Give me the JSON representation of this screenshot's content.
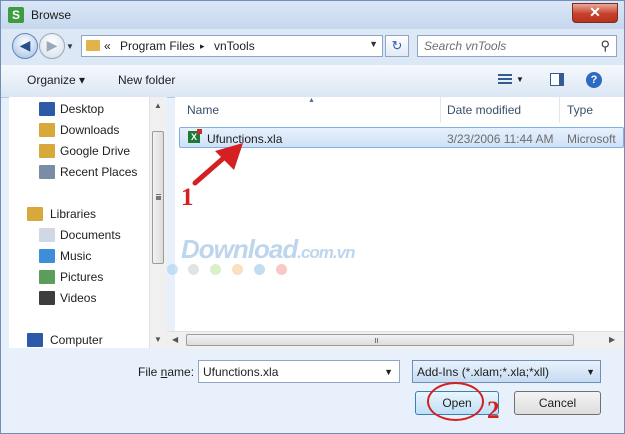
{
  "titlebar": {
    "title": "Browse",
    "close_glyph": "✕",
    "app_icon_letter": "S"
  },
  "nav": {
    "breadcrumb_prefix": "«",
    "crumbs": [
      "Program Files",
      "vnTools"
    ],
    "crumb_sep": "▸",
    "search_placeholder": "Search vnTools"
  },
  "toolbar": {
    "organize": "Organize ▾",
    "new_folder": "New folder",
    "help": "?"
  },
  "sidebar": {
    "items": [
      {
        "label": "Desktop",
        "icon": "desktop-icon",
        "color": "#2c5aa8"
      },
      {
        "label": "Downloads",
        "icon": "downloads-folder-icon",
        "color": "#d9a83a"
      },
      {
        "label": "Google Drive",
        "icon": "google-drive-folder-icon",
        "color": "#d9a83a"
      },
      {
        "label": "Recent Places",
        "icon": "recent-places-icon",
        "color": "#7a8ca6"
      },
      {
        "label": "Libraries",
        "icon": "libraries-icon",
        "color": "#d9a83a"
      },
      {
        "label": "Documents",
        "icon": "documents-icon",
        "color": "#cfd8e4"
      },
      {
        "label": "Music",
        "icon": "music-icon",
        "color": "#3d8fd9"
      },
      {
        "label": "Pictures",
        "icon": "pictures-icon",
        "color": "#5b9e5b"
      },
      {
        "label": "Videos",
        "icon": "videos-icon",
        "color": "#3d3d3d"
      },
      {
        "label": "Computer",
        "icon": "computer-icon",
        "color": "#2c5aa8"
      }
    ]
  },
  "filelist": {
    "columns": [
      "Name",
      "Date modified",
      "Type"
    ],
    "rows": [
      {
        "name": "Ufunctions.xla",
        "date": "3/23/2006 11:44 AM",
        "type": "Microsoft"
      }
    ]
  },
  "watermark": {
    "text": "Download",
    "suffix": ".com.vn",
    "dot_colors": [
      "#9cd0ef",
      "#cccccc",
      "#b9e39a",
      "#f6c58c",
      "#8fc1e6",
      "#f39a9a"
    ]
  },
  "annotations": {
    "step1": "1",
    "step2": "2",
    "color": "#d42020"
  },
  "footer": {
    "filename_label_prefix": "File ",
    "filename_label_key": "n",
    "filename_label_suffix": "ame:",
    "filename_value": "Ufunctions.xla",
    "filetype_value": "Add-Ins (*.xlam;*.xla;*xll)",
    "open": "Open",
    "cancel": "Cancel"
  }
}
